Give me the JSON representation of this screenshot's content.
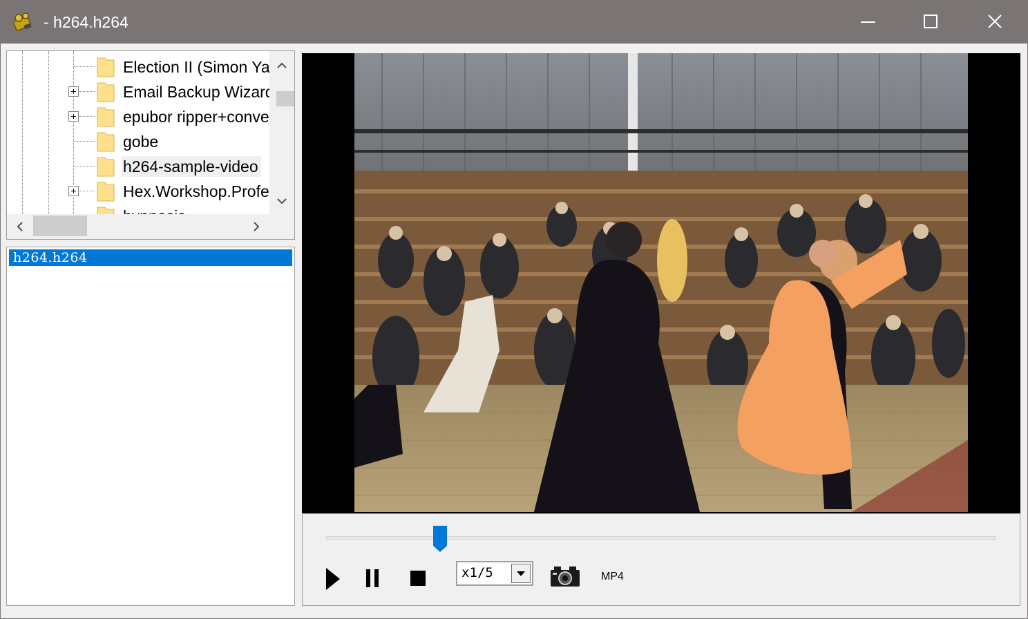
{
  "window": {
    "title": "- h264.h264"
  },
  "titlebar": {
    "app_icon": "film-projector-icon",
    "minimize_icon": "minimize-icon",
    "maximize_icon": "maximize-icon",
    "close_icon": "close-icon"
  },
  "tree": {
    "items": [
      {
        "label": "Election II (Simon Yam",
        "expandable": false
      },
      {
        "label": "Email Backup Wizard",
        "expandable": true
      },
      {
        "label": "epubor ripper+converter",
        "expandable": true
      },
      {
        "label": "gobe",
        "expandable": false
      },
      {
        "label": "h264-sample-video",
        "expandable": false,
        "selected": true
      },
      {
        "label": "Hex.Workshop.Professional",
        "expandable": true
      },
      {
        "label": "hypnosis",
        "expandable": false
      }
    ]
  },
  "file_list": {
    "items": [
      {
        "label": "h264.h264",
        "selected": true
      }
    ]
  },
  "player": {
    "progress": 0.17,
    "speed_value": "x1/5",
    "format_label": "MP4",
    "colors": {
      "accent": "#0078d7",
      "titlebar": "#7a7574"
    }
  }
}
